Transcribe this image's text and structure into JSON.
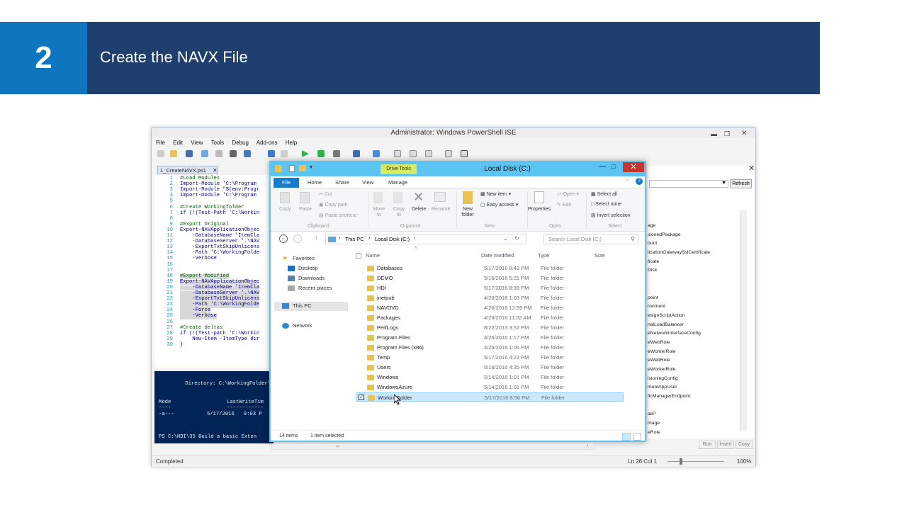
{
  "banner": {
    "number": "2",
    "title": "Create the NAVX File"
  },
  "ise": {
    "title": "Administrator: Windows PowerShell ISE",
    "menu": [
      "File",
      "Edit",
      "View",
      "Tools",
      "Debug",
      "Add-ons",
      "Help"
    ],
    "tab_label": "1_CreateNAVX.ps1",
    "code_lines": [
      {
        "n": "1",
        "t": "#Load Modules",
        "k": "c"
      },
      {
        "n": "2",
        "t": "Import-Module 'C:\\Program",
        "k": ""
      },
      {
        "n": "3",
        "t": "Import-Module \"$(env:Progr",
        "k": ""
      },
      {
        "n": "4",
        "t": "import-module 'C:\\Program",
        "k": ""
      },
      {
        "n": "5",
        "t": "",
        "k": ""
      },
      {
        "n": "6",
        "t": "#Create Workingfolder",
        "k": "c"
      },
      {
        "n": "7",
        "t": "if (!(Test-Path 'C:\\Workin",
        "k": ""
      },
      {
        "n": "8",
        "t": "",
        "k": ""
      },
      {
        "n": "9",
        "t": "#Export Original",
        "k": "c"
      },
      {
        "n": "10",
        "t": "Export-NAVApplicationObjec",
        "k": ""
      },
      {
        "n": "11",
        "t": "    -DatabaseName 'ItemCla",
        "k": ""
      },
      {
        "n": "12",
        "t": "    -DatabaseServer '.\\NAV",
        "k": ""
      },
      {
        "n": "13",
        "t": "    -ExportTxtSkipUnlicens",
        "k": ""
      },
      {
        "n": "14",
        "t": "    -Path 'C:\\WorkingFolde",
        "k": ""
      },
      {
        "n": "15",
        "t": "    -Verbose",
        "k": ""
      },
      {
        "n": "16",
        "t": "",
        "k": ""
      },
      {
        "n": "17",
        "t": "",
        "k": ""
      },
      {
        "n": "18",
        "t": "#Export Modified",
        "k": "ch"
      },
      {
        "n": "19",
        "t": "Export-NAVApplicationObjec",
        "k": "h"
      },
      {
        "n": "20",
        "t": "    -DatabaseName 'ItemCla",
        "k": "h"
      },
      {
        "n": "21",
        "t": "    -DatabaseServer '.\\NAV",
        "k": "h"
      },
      {
        "n": "22",
        "t": "    -ExportTxtSkipUnlicens",
        "k": "h"
      },
      {
        "n": "23",
        "t": "    -Path 'C:\\WorkingFolde",
        "k": "h"
      },
      {
        "n": "24",
        "t": "    -Force",
        "k": "h"
      },
      {
        "n": "25",
        "t": "    -Verbose",
        "k": "h"
      },
      {
        "n": "26",
        "t": "",
        "k": ""
      },
      {
        "n": "27",
        "t": "#Create deltas",
        "k": "c"
      },
      {
        "n": "28",
        "t": "if (!(Test-path 'C:\\Workin",
        "k": ""
      },
      {
        "n": "29",
        "t": "    New-Item -ItemType dir",
        "k": ""
      },
      {
        "n": "30",
        "t": "}",
        "k": ""
      }
    ],
    "console": {
      "directory": "    Directory: C:\\WorkingFolder\\",
      "col_mode": "Mode",
      "col_last": "LastWriteTim",
      "dash_mode": "----",
      "dash_last": "------------",
      "row_mode": "-a---",
      "row_date": "5/17/2016   9:03 P",
      "prompt": "PS C:\\HDI\\35 Build a basic Exten"
    },
    "commands_button": "Refresh",
    "commands": [
      "age",
      "sionedPackage",
      "ount",
      "licationGatewaySslCertificate",
      "ficate",
      "Disk",
      "",
      "",
      "point",
      "ronment",
      "esignScriptAction",
      "nalLoadBalancer",
      "eNetworkInterfaceConfig",
      "eWebRole",
      "eWorkerRole",
      "eWebRole",
      "eWorkerRole",
      "isioningConfig",
      "moteAppUser",
      "ficManagerEndpoint",
      "",
      "ailP",
      "mage",
      "eRole"
    ],
    "cmd_buttons": [
      "Run",
      "Insert",
      "Copy"
    ],
    "status_left": "Completed",
    "status_pos": "Ln 26  Col 1",
    "zoom": "100%"
  },
  "explorer": {
    "title": "Local Disk (C:)",
    "context_tab": "Drive Tools",
    "tabs": [
      "File",
      "Home",
      "Share",
      "View",
      "Manage"
    ],
    "ribbon": {
      "copy": "Copy",
      "paste": "Paste",
      "cut": "Cut",
      "copy_path": "Copy path",
      "paste_shortcut": "Paste shortcut",
      "move_to": "Move to",
      "copy_to": "Copy to",
      "delete": "Delete",
      "rename": "Rename",
      "new_folder": "New folder",
      "new_item": "New item",
      "easy_access": "Easy access",
      "properties": "Properties",
      "open": "Open",
      "edit": "Edit",
      "select_all": "Select all",
      "select_none": "Select none",
      "invert_selection": "Invert selection",
      "groups": [
        "Clipboard",
        "Organize",
        "New",
        "Open",
        "Select"
      ]
    },
    "path": [
      "This PC",
      "Local Disk (C:)"
    ],
    "search_placeholder": "Search Local Disk (C:)",
    "nav": {
      "favorites": "Favorites",
      "desktop": "Desktop",
      "downloads": "Downloads",
      "recent": "Recent places",
      "this_pc": "This PC",
      "network": "Network"
    },
    "columns": [
      "Name",
      "Date modified",
      "Type",
      "Size"
    ],
    "rows": [
      {
        "name": "Databases",
        "date": "5/17/2016 8:43 PM",
        "type": "File folder"
      },
      {
        "name": "DEMO",
        "date": "5/16/2016 5:21 PM",
        "type": "File folder"
      },
      {
        "name": "HDI",
        "date": "5/17/2016 8:39 PM",
        "type": "File folder"
      },
      {
        "name": "inetpub",
        "date": "4/26/2016 1:03 PM",
        "type": "File folder"
      },
      {
        "name": "NAVDVD",
        "date": "4/26/2016 12:59 PM",
        "type": "File folder"
      },
      {
        "name": "Packages",
        "date": "4/26/2016 11:02 AM",
        "type": "File folder"
      },
      {
        "name": "PerfLogs",
        "date": "8/22/2013 3:52 PM",
        "type": "File folder"
      },
      {
        "name": "Program Files",
        "date": "4/26/2016 1:17 PM",
        "type": "File folder"
      },
      {
        "name": "Program Files (x86)",
        "date": "4/26/2016 1:06 PM",
        "type": "File folder"
      },
      {
        "name": "Temp",
        "date": "5/17/2016 4:23 PM",
        "type": "File folder"
      },
      {
        "name": "Users",
        "date": "5/16/2016 4:35 PM",
        "type": "File folder"
      },
      {
        "name": "Windows",
        "date": "5/14/2016 1:01 PM",
        "type": "File folder"
      },
      {
        "name": "WindowsAzure",
        "date": "5/14/2016 1:01 PM",
        "type": "File folder"
      },
      {
        "name": "WorkingFolder",
        "date": "5/17/2016 8:56 PM",
        "type": "File folder",
        "selected": true
      }
    ],
    "status_items": "14 items",
    "status_selected": "1 item selected"
  }
}
